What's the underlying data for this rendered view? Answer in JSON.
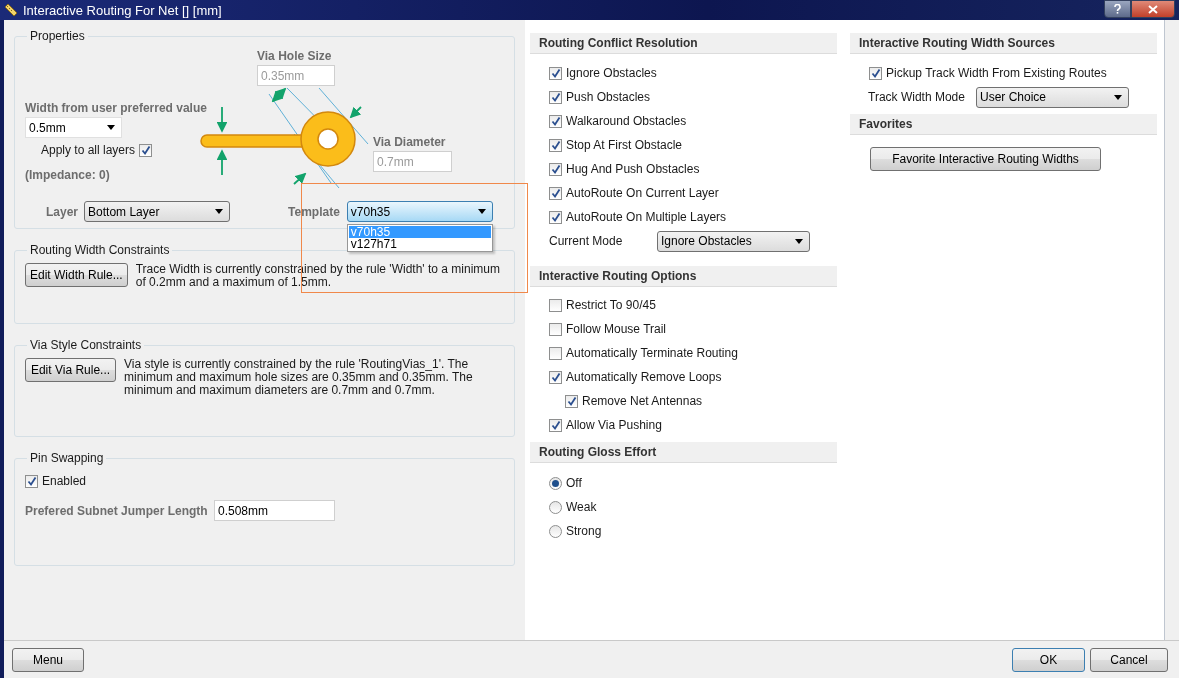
{
  "window": {
    "title": "Interactive Routing For Net [] [mm]"
  },
  "properties": {
    "title": "Properties",
    "via_hole_size": {
      "label": "Via Hole Size",
      "value": "0.35mm",
      "disabled": true
    },
    "width": {
      "label": "Width from user preferred value",
      "value": "0.5mm"
    },
    "apply_to_all_layers": {
      "label": "Apply to all layers",
      "checked": true
    },
    "impedance": "(Impedance: 0)",
    "via_diameter": {
      "label": "Via Diameter",
      "value": "0.7mm",
      "disabled": true
    },
    "layer": {
      "label": "Layer",
      "value": "Bottom Layer"
    },
    "template": {
      "label": "Template",
      "value": "v70h35",
      "expanded": true,
      "options": [
        {
          "label": "v70h35",
          "selected": true
        },
        {
          "label": "v127h71",
          "selected": false
        }
      ]
    }
  },
  "routing_width_constraints": {
    "title": "Routing Width Constraints",
    "button": "Edit Width Rule...",
    "text": "Trace Width is currently constrained by the rule 'Width' to a minimum of 0.2mm and a maximum of 1.5mm."
  },
  "via_style_constraints": {
    "title": "Via Style Constraints",
    "button": "Edit Via Rule...",
    "text": "Via style is currently constrained by the rule 'RoutingVias_1'. The minimum and maximum hole sizes are 0.35mm and 0.35mm. The minimum and maximum diameters are 0.7mm and 0.7mm."
  },
  "pin_swapping": {
    "title": "Pin Swapping",
    "enabled": {
      "label": "Enabled",
      "checked": true
    },
    "jumper_length": {
      "label": "Prefered Subnet Jumper Length",
      "value": "0.508mm"
    }
  },
  "routing_conflict_resolution": {
    "title": "Routing Conflict Resolution",
    "options": [
      {
        "label": "Ignore Obstacles",
        "checked": true
      },
      {
        "label": "Push Obstacles",
        "checked": true
      },
      {
        "label": "Walkaround Obstacles",
        "checked": true
      },
      {
        "label": "Stop At First Obstacle",
        "checked": true
      },
      {
        "label": "Hug And Push Obstacles",
        "checked": true
      },
      {
        "label": "AutoRoute On Current Layer",
        "checked": true
      },
      {
        "label": "AutoRoute On Multiple Layers",
        "checked": true
      }
    ],
    "current_mode": {
      "label": "Current Mode",
      "value": "Ignore Obstacles"
    }
  },
  "interactive_routing_options": {
    "title": "Interactive Routing Options",
    "options": [
      {
        "label": "Restrict To 90/45",
        "checked": false
      },
      {
        "label": "Follow Mouse Trail",
        "checked": false
      },
      {
        "label": "Automatically Terminate Routing",
        "checked": false
      },
      {
        "label": "Automatically Remove Loops",
        "checked": true,
        "children": [
          {
            "label": "Remove Net Antennas",
            "checked": true
          }
        ]
      },
      {
        "label": "Allow Via Pushing",
        "checked": true
      }
    ]
  },
  "routing_gloss_effort": {
    "title": "Routing Gloss Effort",
    "options": [
      {
        "label": "Off",
        "selected": true
      },
      {
        "label": "Weak",
        "selected": false
      },
      {
        "label": "Strong",
        "selected": false
      }
    ]
  },
  "width_sources": {
    "title": "Interactive Routing Width Sources",
    "pickup": {
      "label": "Pickup Track Width From Existing Routes",
      "checked": true
    },
    "track_width_mode": {
      "label": "Track Width Mode",
      "value": "User Choice"
    }
  },
  "favorites": {
    "title": "Favorites",
    "button": "Favorite Interactive Routing Widths"
  },
  "footer": {
    "menu": "Menu",
    "ok": "OK",
    "cancel": "Cancel"
  }
}
